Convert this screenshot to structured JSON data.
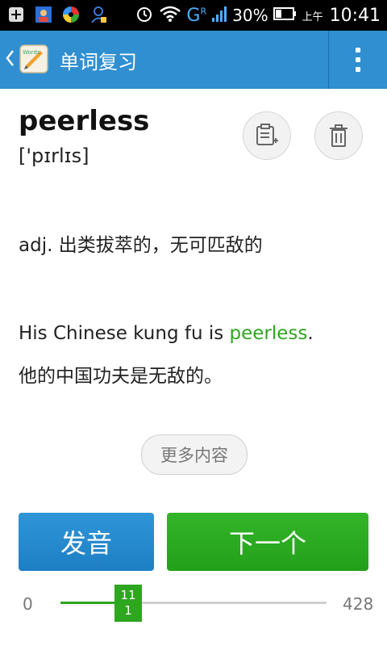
{
  "status_bar": {
    "network": "G",
    "roaming": "R",
    "battery": "30%",
    "ampm": "上午",
    "time": "10:41"
  },
  "app_bar": {
    "title": "单词复习",
    "app_icon_text": "Words"
  },
  "word": {
    "headword": "peerless",
    "phonetic": "['pɪrlɪs]",
    "definition": "adj. 出类拔萃的，无可匹敌的",
    "example_before": "His Chinese kung fu is ",
    "example_highlight": "peerless",
    "example_after": ".",
    "example_translation": "他的中国功夫是无敌的。"
  },
  "buttons": {
    "more": "更多内容",
    "pronounce": "发音",
    "next": "下一个"
  },
  "progress": {
    "min": "0",
    "max": "428",
    "current": "111",
    "fraction": 0.259
  },
  "colors": {
    "app_bar": "#2f8fd1",
    "accent_green": "#2ea61f",
    "pronounce_button": "#1e7fc4"
  }
}
